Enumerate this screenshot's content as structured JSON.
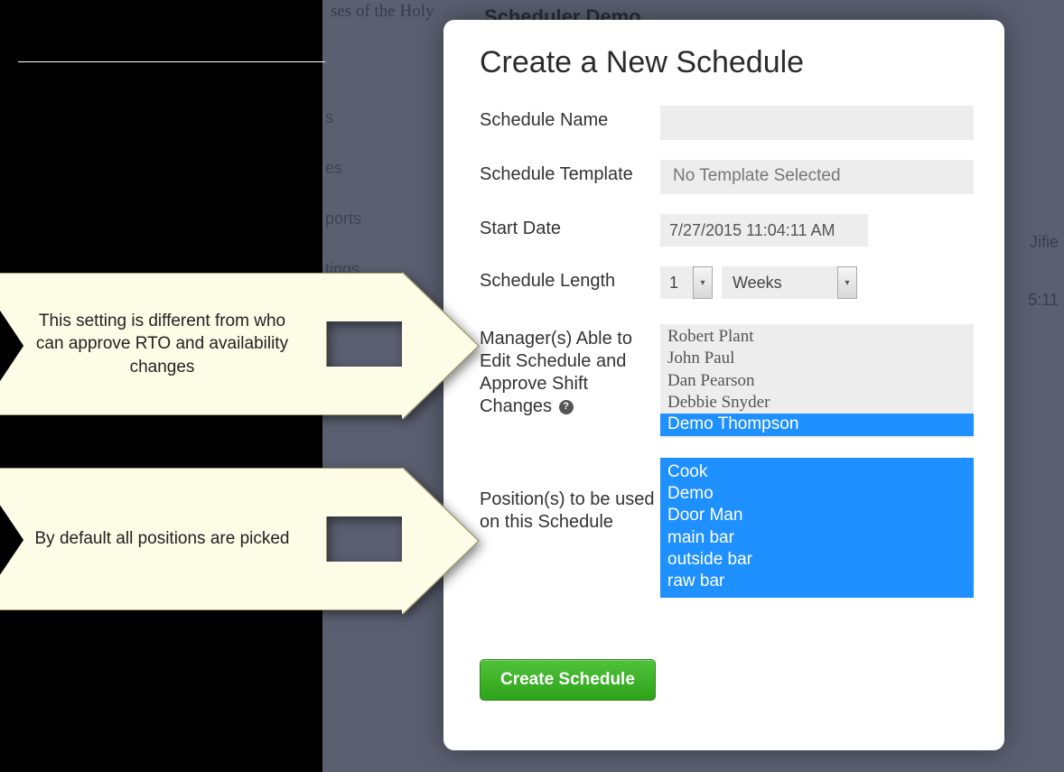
{
  "background": {
    "snippet1": "ses of the Holy",
    "header": "Scheduler Demo",
    "menu": [
      "s",
      "es",
      "ports",
      "tings"
    ],
    "right1": "Jifie",
    "right2": "5:11"
  },
  "callouts": {
    "c1": "This setting is different from who can approve RTO and availability changes",
    "c2": "By default all positions are picked"
  },
  "dialog": {
    "title": "Create a New Schedule",
    "labels": {
      "name": "Schedule Name",
      "template": "Schedule Template",
      "startDate": "Start Date",
      "length": "Schedule Length",
      "managers": "Manager(s) Able to Edit Schedule and Approve Shift Changes",
      "positions": "Position(s) to be used on this Schedule"
    },
    "values": {
      "name": "",
      "template": "No Template Selected",
      "startDate": "7/27/2015 11:04:11 AM",
      "lengthNum": "1",
      "lengthUnit": "Weeks"
    },
    "managers": [
      {
        "name": "Robert Plant",
        "selected": false
      },
      {
        "name": "John Paul",
        "selected": false
      },
      {
        "name": "Dan Pearson",
        "selected": false
      },
      {
        "name": "Debbie Snyder",
        "selected": false
      },
      {
        "name": "Demo Thompson",
        "selected": true
      }
    ],
    "positions": [
      {
        "name": "Cook",
        "selected": true
      },
      {
        "name": "Demo",
        "selected": true
      },
      {
        "name": "Door Man",
        "selected": true
      },
      {
        "name": "main bar",
        "selected": true
      },
      {
        "name": "outside bar",
        "selected": true
      },
      {
        "name": "raw bar",
        "selected": true
      }
    ],
    "createButton": "Create Schedule",
    "help": "?"
  }
}
